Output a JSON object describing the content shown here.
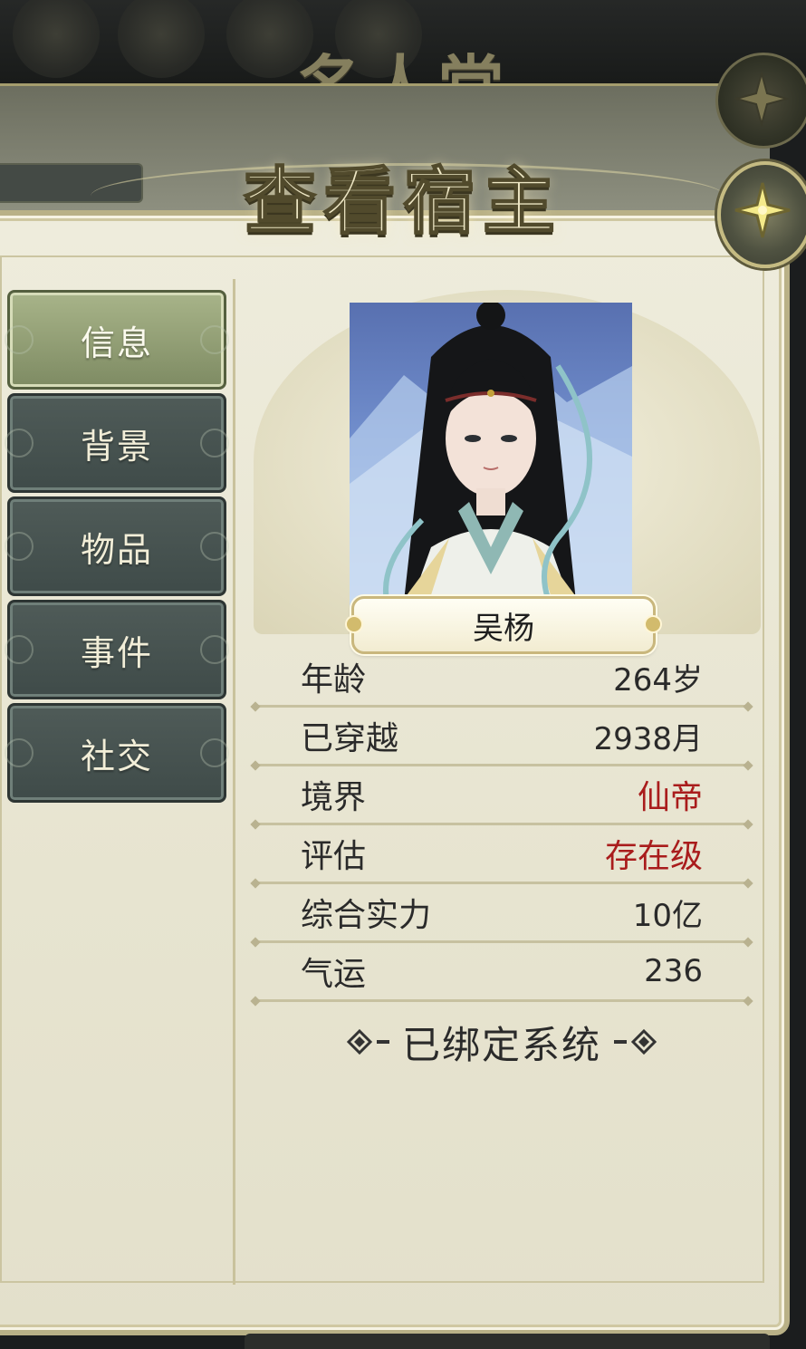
{
  "background": {
    "title": "名人堂"
  },
  "dialog": {
    "title": "查看宿主"
  },
  "tabs": [
    {
      "label": "信息",
      "active": true
    },
    {
      "label": "背景",
      "active": false
    },
    {
      "label": "物品",
      "active": false
    },
    {
      "label": "事件",
      "active": false
    },
    {
      "label": "社交",
      "active": false
    }
  ],
  "host": {
    "name": "吴杨",
    "stats": [
      {
        "label": "年龄",
        "value": "264岁"
      },
      {
        "label": "已穿越",
        "value": "2938月"
      },
      {
        "label": "境界",
        "value": "仙帝"
      },
      {
        "label": "评估",
        "value": "存在级"
      },
      {
        "label": "综合实力",
        "value": "10亿"
      },
      {
        "label": "气运",
        "value": "236"
      }
    ],
    "system_status": "已绑定系统"
  },
  "colors": {
    "accent_red": "#a91c1c",
    "panel_bg": "#eae7d4",
    "active_tab": "#8e9b70",
    "inactive_tab": "#465250"
  },
  "icons": {
    "close": "shuriken-close-icon",
    "system_ornament": "diamond-ornament-icon"
  }
}
